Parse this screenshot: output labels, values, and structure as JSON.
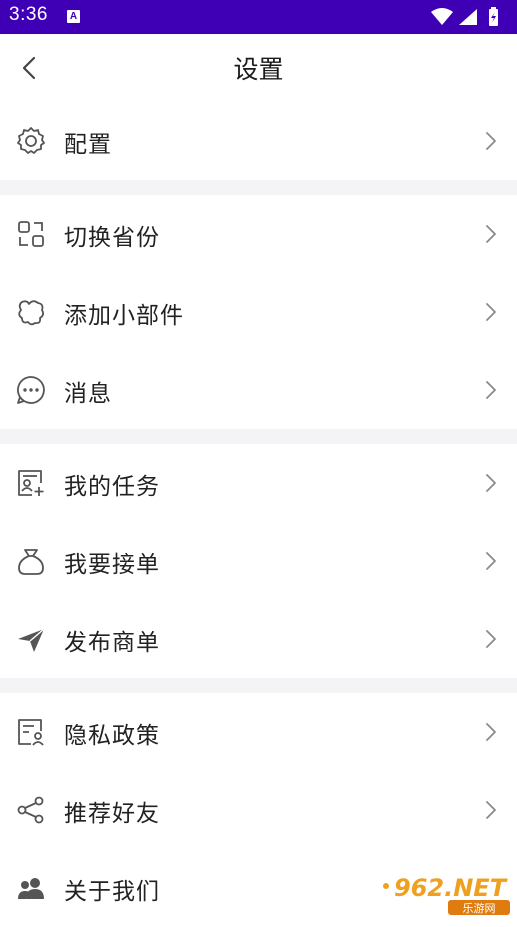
{
  "status_bar": {
    "time": "3:36",
    "notif_letter": "A"
  },
  "header": {
    "title": "设置"
  },
  "rows": [
    {
      "label": "配置"
    },
    {
      "label": "切换省份"
    },
    {
      "label": "添加小部件"
    },
    {
      "label": "消息"
    },
    {
      "label": "我的任务"
    },
    {
      "label": "我要接单"
    },
    {
      "label": "发布商单"
    },
    {
      "label": "隐私政策"
    },
    {
      "label": "推荐好友"
    },
    {
      "label": "关于我们"
    }
  ],
  "watermark": {
    "brand": "962.NET",
    "sub": "乐游网"
  },
  "colors": {
    "status_bar": "#3f00b5",
    "divider": "#f4f4f6",
    "text": "#222222",
    "icon": "#555555"
  }
}
